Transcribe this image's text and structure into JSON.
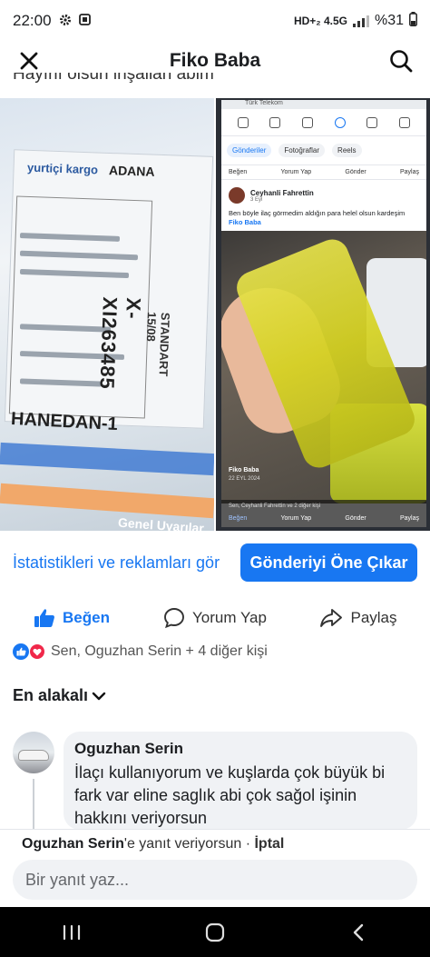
{
  "status_bar": {
    "time": "22:00",
    "network": "HD+₂ 4.5G",
    "battery": "%31"
  },
  "header": {
    "title": "Fiko Baba"
  },
  "caption_partial": "Hayırlı olsun inşallah abim",
  "photo_left": {
    "brand": "yurtiçi kargo",
    "city": "ADANA",
    "code": "X-XI263485",
    "standard": "STANDART 15/08",
    "branch": "HANEDAN-1",
    "warning_title": "Genel Uyarılar"
  },
  "photo_right": {
    "carrier": "Türk Telekom",
    "tabs": [
      "Gönderiler",
      "Fotoğraflar",
      "Reels"
    ],
    "actions": [
      "Beğen",
      "Yorum Yap",
      "Gönder",
      "Paylaş"
    ],
    "post_author": "Ceyhanli Fahrettin",
    "post_date": "3 Eyl",
    "post_text": "Ben böyle ilaç görmedim aldığın para helel olsun kardeşim",
    "post_mention": "Fiko Baba",
    "overlay_name": "Fiko Baba",
    "overlay_date": "22 EYL 2024",
    "likes_line": "Sen, Ceyhanli Fahrettin ve 2 diğer kişi",
    "bottom_actions": [
      "Beğen",
      "Yorum Yap",
      "Gönder",
      "Paylaş"
    ]
  },
  "promo": {
    "link": "İstatistikleri ve reklamları gör",
    "button": "Gönderiyi Öne Çıkar"
  },
  "actions": {
    "like": "Beğen",
    "comment": "Yorum Yap",
    "share": "Paylaş"
  },
  "reactions": {
    "text": "Sen, Oguzhan Serin + 4 diğer kişi"
  },
  "sort": {
    "label": "En alakalı"
  },
  "comment": {
    "author": "Oguzhan Serin",
    "text": "İlaçı kullanıyorum ve kuşlarda çok büyük bi fark var eline saglık abi çok sağol işinin hakkını veriyorsun"
  },
  "reply": {
    "replying_name": "Oguzhan Serin",
    "replying_suffix": "'e yanıt veriyorsun · ",
    "cancel": "İptal",
    "placeholder": "Bir yanıt yaz..."
  },
  "colors": {
    "accent": "#1877f2",
    "love": "#f0284a",
    "bubble": "#f0f2f5"
  }
}
